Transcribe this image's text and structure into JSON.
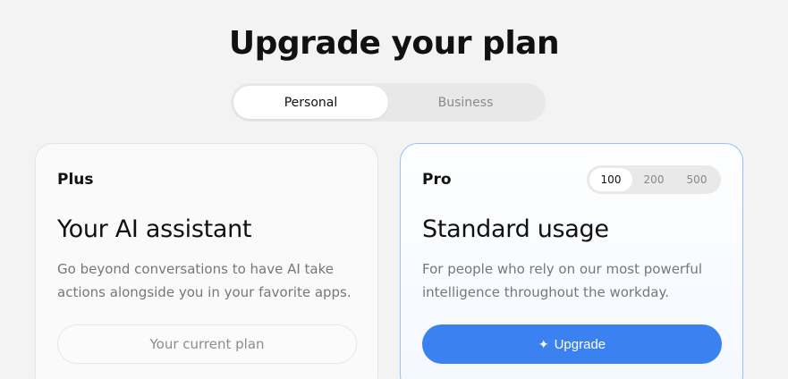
{
  "header": {
    "title": "Upgrade your plan"
  },
  "plan_type_toggle": {
    "options": [
      "Personal",
      "Business"
    ],
    "selected": "Personal"
  },
  "plans": {
    "plus": {
      "name": "Plus",
      "headline": "Your AI assistant",
      "description": "Go beyond conversations to have AI take actions alongside you in your favorite apps.",
      "button_label": "Your current plan"
    },
    "pro": {
      "name": "Pro",
      "usage_options": [
        "100",
        "200",
        "500"
      ],
      "usage_selected": "100",
      "headline": "Standard usage",
      "description": "For people who rely on our most powerful intelligence throughout the workday.",
      "button_label": "Upgrade",
      "button_icon": "sparkle-icon"
    }
  },
  "colors": {
    "accent": "#3b82f0",
    "pro_border": "#9cc0f5",
    "background": "#f3f3f3"
  }
}
